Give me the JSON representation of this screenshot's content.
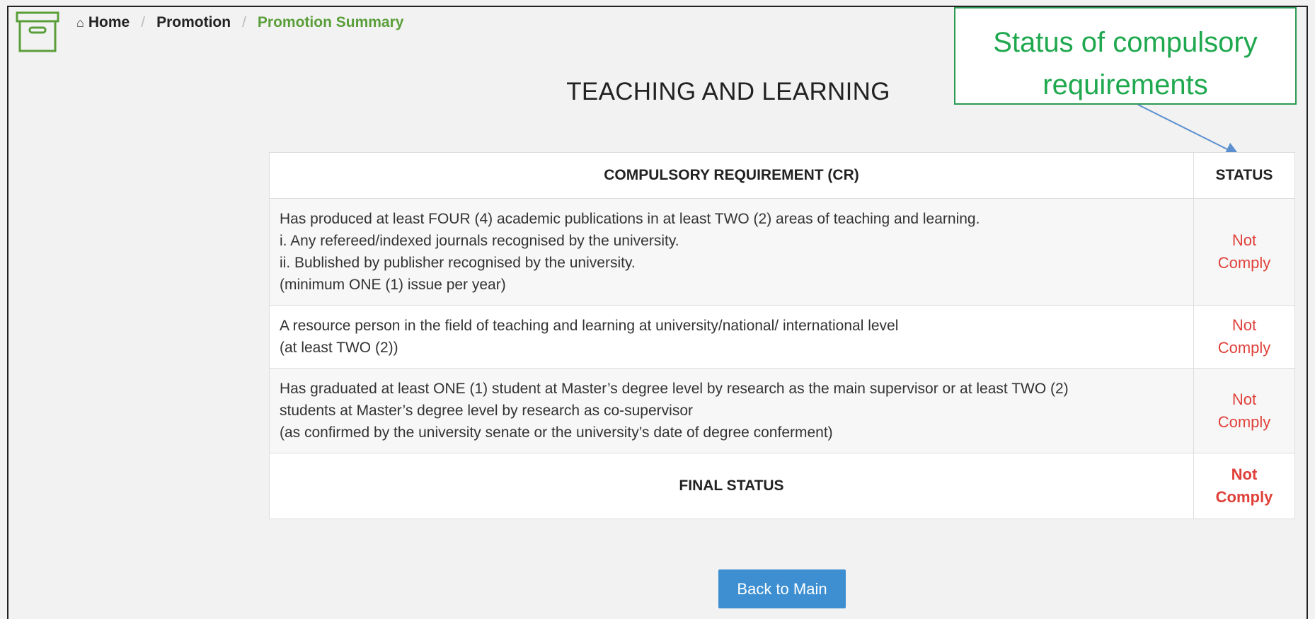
{
  "breadcrumb": {
    "home": "Home",
    "promotion": "Promotion",
    "current": "Promotion Summary"
  },
  "title": "TEACHING AND LEARNING",
  "callout": {
    "line1": "Status of compulsory",
    "line2": "requirements"
  },
  "table": {
    "header_requirement": "COMPULSORY REQUIREMENT (CR)",
    "header_status": "STATUS",
    "rows": [
      {
        "lines": [
          "Has produced at least FOUR (4) academic publications in at least TWO (2) areas of teaching and learning.",
          "i. Any refereed/indexed journals recognised by the university.",
          "ii. Bublished by publisher recognised by the university.",
          "(minimum ONE (1) issue per year)"
        ],
        "status_line1": "Not",
        "status_line2": "Comply"
      },
      {
        "lines": [
          "A resource person in the field of teaching and learning at university/national/ international level",
          "(at least TWO (2))"
        ],
        "status_line1": "Not",
        "status_line2": "Comply"
      },
      {
        "lines": [
          "Has graduated at least ONE (1) student at Master’s degree level by research as the main supervisor or at least TWO (2)",
          "students at Master’s degree level by research as co-supervisor",
          "(as confirmed by the university senate or the university’s date of degree conferment)"
        ],
        "status_line1": "Not",
        "status_line2": "Comply"
      }
    ],
    "final_label": "FINAL STATUS",
    "final_status_line1": "Not",
    "final_status_line2": "Comply"
  },
  "back_button": "Back to Main",
  "colors": {
    "breadcrumb_active": "#5a9e3a",
    "status_red": "#e0403a",
    "button_blue": "#3d8fd1",
    "callout_green": "#1fa84e"
  }
}
